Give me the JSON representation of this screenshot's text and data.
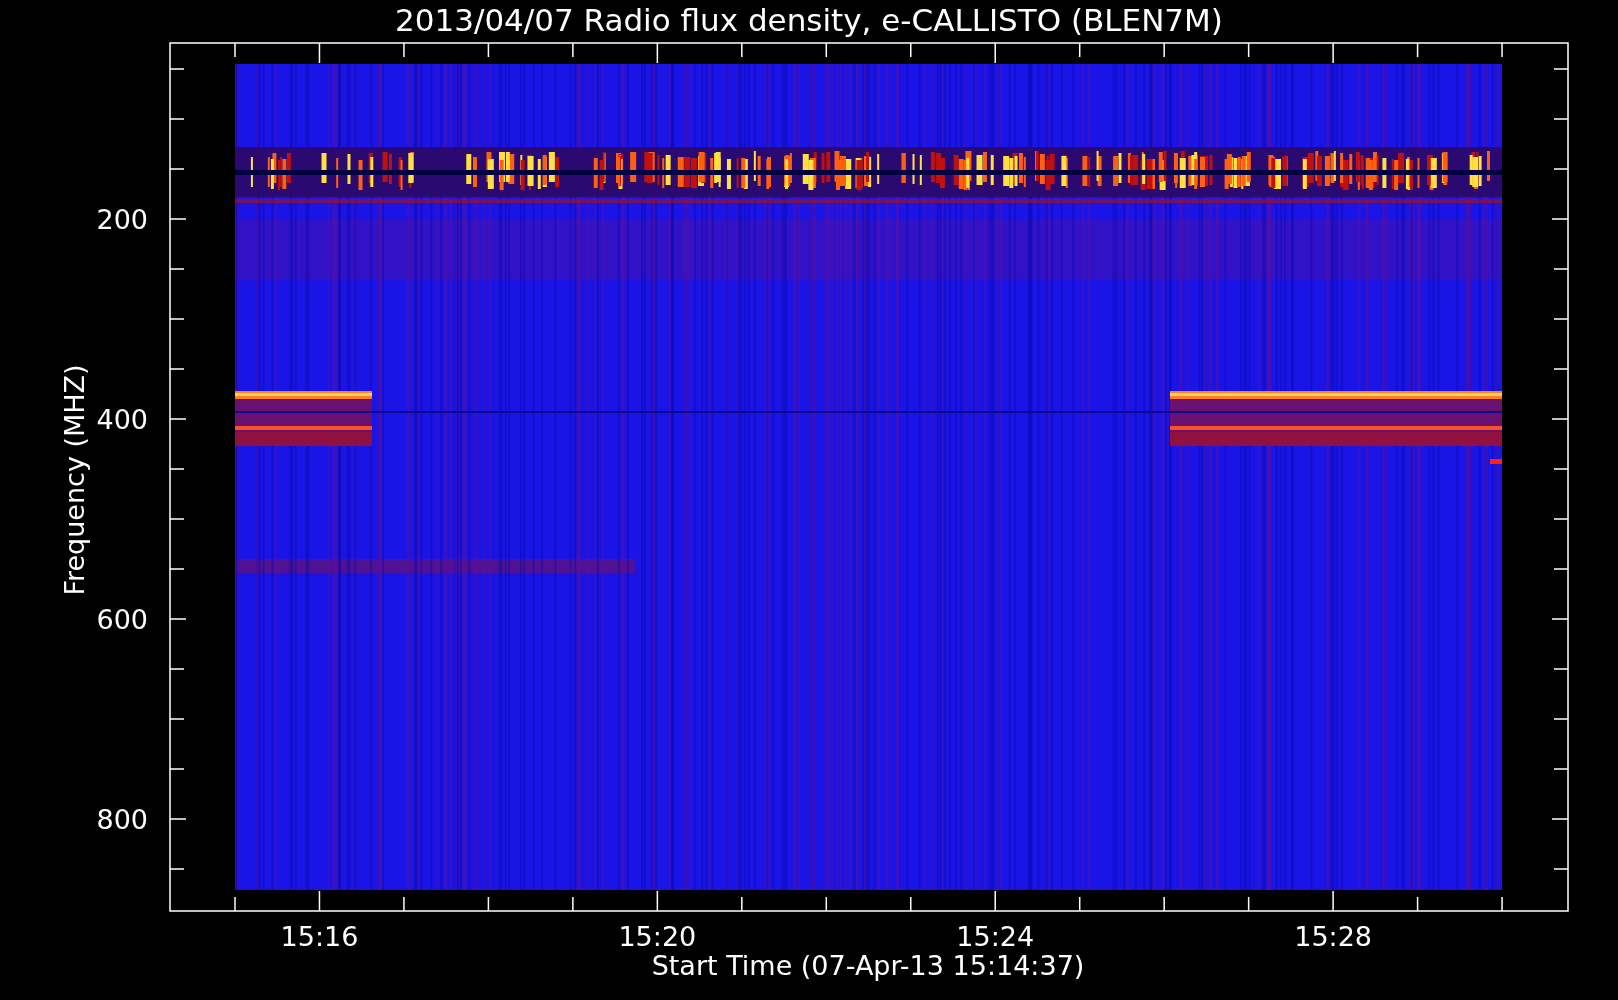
{
  "title": "2013/04/07  Radio flux density, e-CALLISTO (BLEN7M)",
  "y_axis": {
    "label": "Frequency (MHZ)",
    "tick_labels": [
      "200",
      "400",
      "600",
      "800"
    ]
  },
  "x_axis": {
    "label": "Start Time (07-Apr-13 15:14:37)",
    "tick_labels": [
      "15:16",
      "15:20",
      "15:24",
      "15:28"
    ]
  }
}
